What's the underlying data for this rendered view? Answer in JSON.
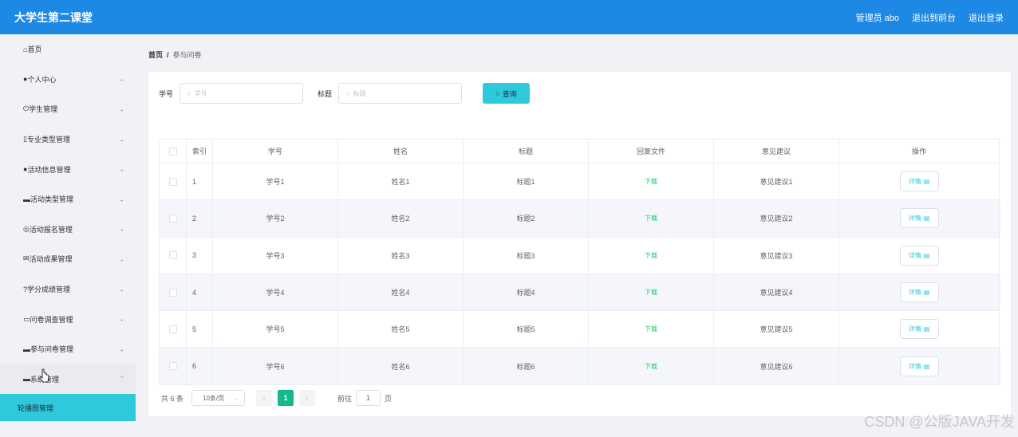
{
  "header": {
    "title": "大学生第二课堂",
    "admin": "管理员 abo",
    "back_to_front": "退出到前台",
    "logout": "退出登录"
  },
  "sidebar": {
    "items": [
      {
        "label": "首页",
        "icon": "home-icon",
        "chevron": ""
      },
      {
        "label": "个人中心",
        "icon": "user-icon",
        "chevron": "⌄"
      },
      {
        "label": "学生管理",
        "icon": "power-icon",
        "chevron": "⌄"
      },
      {
        "label": "专业类型管理",
        "icon": "mic-icon",
        "chevron": "⌄"
      },
      {
        "label": "活动信息管理",
        "icon": "pin-icon",
        "chevron": "⌄"
      },
      {
        "label": "活动类型管理",
        "icon": "chat-icon",
        "chevron": "⌄"
      },
      {
        "label": "活动报名管理",
        "icon": "target-icon",
        "chevron": "⌄"
      },
      {
        "label": "活动成果管理",
        "icon": "mail-icon",
        "chevron": "⌄"
      },
      {
        "label": "学分成绩管理",
        "icon": "help-icon",
        "chevron": "⌄"
      },
      {
        "label": "问卷调查管理",
        "icon": "message-icon",
        "chevron": "⌄"
      },
      {
        "label": "参与问卷管理",
        "icon": "chat-solid-icon",
        "chevron": "⌄"
      },
      {
        "label": "系统管理",
        "icon": "briefcase-icon",
        "chevron": "⌃"
      }
    ],
    "submenu": "轮播图管理"
  },
  "breadcrumb": {
    "home": "首页",
    "separator": "/",
    "current": "参与问卷"
  },
  "search": {
    "student_id_label": "学号",
    "student_id_placeholder": "学号",
    "title_label": "标题",
    "title_placeholder": "标题",
    "query_button": "查询"
  },
  "table": {
    "headers": [
      "索引",
      "学号",
      "姓名",
      "标题",
      "回复文件",
      "意见建议",
      "操作"
    ],
    "rows": [
      {
        "idx": "1",
        "sid": "学号1",
        "name": "姓名1",
        "title": "标题1",
        "file": "下载",
        "advice": "意见建议1",
        "action": "详情"
      },
      {
        "idx": "2",
        "sid": "学号2",
        "name": "姓名2",
        "title": "标题2",
        "file": "下载",
        "advice": "意见建议2",
        "action": "详情"
      },
      {
        "idx": "3",
        "sid": "学号3",
        "name": "姓名3",
        "title": "标题3",
        "file": "下载",
        "advice": "意见建议3",
        "action": "详情"
      },
      {
        "idx": "4",
        "sid": "学号4",
        "name": "姓名4",
        "title": "标题4",
        "file": "下载",
        "advice": "意见建议4",
        "action": "详情"
      },
      {
        "idx": "5",
        "sid": "学号5",
        "name": "姓名5",
        "title": "标题5",
        "file": "下载",
        "advice": "意见建议5",
        "action": "详情"
      },
      {
        "idx": "6",
        "sid": "学号6",
        "name": "姓名6",
        "title": "标题6",
        "file": "下载",
        "advice": "意见建议6",
        "action": "详情"
      }
    ]
  },
  "pagination": {
    "total": "共 6 条",
    "page_size": "10条/页",
    "prev": "‹",
    "current_page": "1",
    "next": "›",
    "goto_label": "前往",
    "goto_value": "1",
    "page_suffix": "页"
  },
  "watermark": "CSDN @公版JAVA开发",
  "colors": {
    "header_bg": "#1e88e5",
    "accent": "#2fc9dc",
    "download": "#13ce66",
    "page_active": "#13b98a"
  }
}
